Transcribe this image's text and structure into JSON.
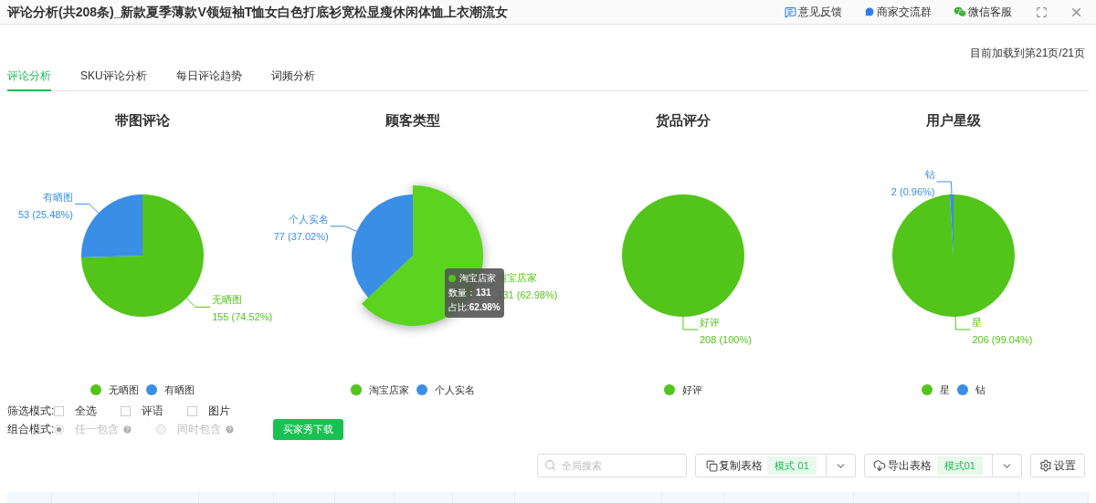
{
  "window": {
    "title": "评论分析(共208条)_新款夏季薄款V领短袖T恤女白色打底衫宽松显瘦休闲体恤上衣潮流女",
    "actions": [
      {
        "kind": "feedback",
        "label": "意见反馈"
      },
      {
        "kind": "group",
        "label": "商家交流群"
      },
      {
        "kind": "wechat",
        "label": "微信客服"
      }
    ]
  },
  "load_status": "目前加载到第21页/21页",
  "tabs": [
    {
      "label": "评论分析",
      "selected": true
    },
    {
      "label": "SKU评论分析",
      "selected": false
    },
    {
      "label": "每日评论趋势",
      "selected": false
    },
    {
      "label": "词频分析",
      "selected": false
    }
  ],
  "charts": [
    {
      "legend": [
        {
          "label": "无晒图",
          "color": "#52c41a",
          "highlighted": false
        },
        {
          "label": "有晒图",
          "color": "#3a8ee6",
          "highlighted": false
        }
      ],
      "chart_data": {
        "type": "pie",
        "title": "带图评论",
        "categories": [
          "无晒图",
          "有晒图"
        ],
        "values": [
          74.52,
          25.48
        ],
        "colors": [
          "#52c41a",
          "#3a8ee6"
        ],
        "value_labels": [
          "155 (74.52%)",
          "53 (25.48%)"
        ]
      }
    },
    {
      "legend": [
        {
          "label": "淘宝店家",
          "color": "#52c41a",
          "highlighted": true
        },
        {
          "label": "个人实名",
          "color": "#3a8ee6",
          "highlighted": false
        }
      ],
      "chart_data": {
        "type": "pie",
        "title": "顾客类型",
        "categories": [
          "淘宝店家",
          "个人实名"
        ],
        "values": [
          62.98,
          37.02
        ],
        "colors": [
          "#52c41a",
          "#3a8ee6"
        ],
        "value_labels": [
          "131 (62.98%)",
          "77 (37.02%)"
        ]
      },
      "tooltip": {
        "name": "淘宝店家",
        "count": "数量：**131**",
        "share": "占比:**62.98%**"
      }
    },
    {
      "legend": [
        {
          "label": "好评",
          "color": "#52c41a",
          "highlighted": false
        }
      ],
      "chart_data": {
        "type": "pie",
        "title": "货品评分",
        "categories": [
          "好评"
        ],
        "values": [
          100
        ],
        "colors": [
          "#52c41a"
        ],
        "value_labels": [
          "208 (100%)"
        ]
      }
    },
    {
      "legend": [
        {
          "label": "星",
          "color": "#52c41a",
          "highlighted": false
        },
        {
          "label": "钻",
          "color": "#3a8ee6",
          "highlighted": false
        }
      ],
      "chart_data": {
        "type": "pie",
        "title": "用户星级",
        "categories": [
          "星",
          "钻"
        ],
        "values": [
          99.04,
          0.96
        ],
        "colors": [
          "#52c41a",
          "#3a8ee6"
        ],
        "value_labels": [
          "206 (99.04%)",
          "2 (0.96%)"
        ]
      }
    }
  ],
  "filter": {
    "label": "筛选模式:",
    "options": [
      {
        "label": "全选",
        "checked": false
      },
      {
        "label": "评语",
        "checked": false
      },
      {
        "label": "图片",
        "checked": false
      }
    ]
  },
  "combine": {
    "label": "组合模式:",
    "options": [
      {
        "label": "任一包含",
        "selected": true,
        "disabled": true
      },
      {
        "label": "同时包含",
        "selected": false,
        "disabled": true
      }
    ]
  },
  "download_button": "买家秀下载",
  "toolbar": {
    "search": {
      "placeholder": "全局搜索"
    },
    "copy": {
      "label": "复制表格",
      "mode": "模式 01"
    },
    "export": {
      "label": "导出表格",
      "mode": "模式01"
    },
    "settings": {
      "label": "设置"
    }
  }
}
